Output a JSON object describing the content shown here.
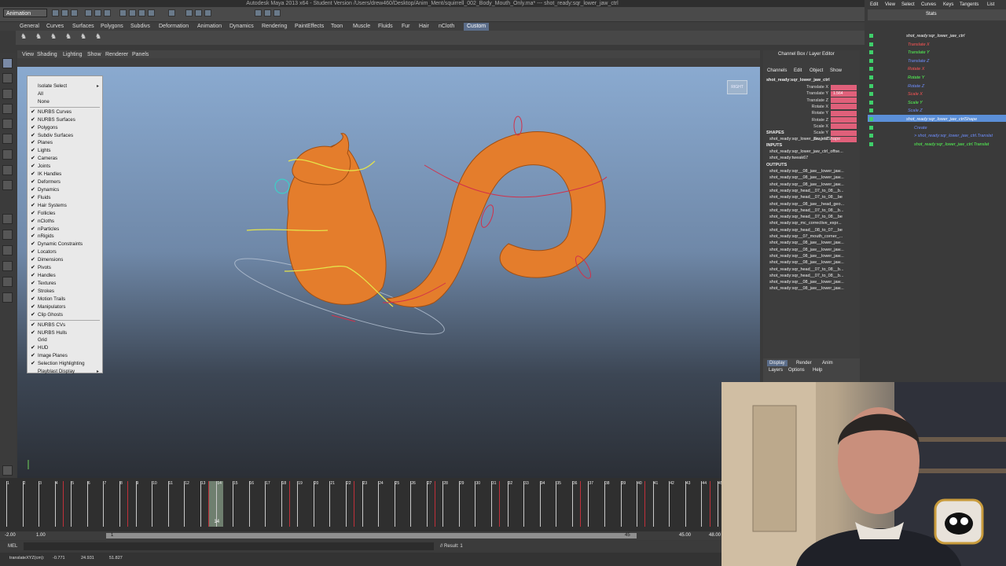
{
  "window": {
    "title": "Autodesk Maya 2013 x64 - Student Version  /Users/drew460/Desktop/Anim_Ment/squirrell_002_Body_Mouth_Only.ma*   ---   shot_ready:sqr_lower_jaw_ctrl"
  },
  "toolbar": {
    "mode": "Animation"
  },
  "shelf_tabs": [
    "General",
    "Curves",
    "Surfaces",
    "Polygons",
    "Subdivs",
    "Deformation",
    "Animation",
    "Dynamics",
    "Rendering",
    "PaintEffects",
    "Toon",
    "Muscle",
    "Fluids",
    "Fur",
    "Hair",
    "nCloth",
    "Custom"
  ],
  "shelf_tabs_active": "Custom",
  "panel_menu": [
    "View",
    "Shading",
    "Lighting",
    "Show",
    "Renderer",
    "Panels"
  ],
  "show_menu": {
    "items": [
      {
        "label": "Isolate Select",
        "check": false,
        "submenu": true
      },
      {
        "label": "All",
        "check": false
      },
      {
        "label": "None",
        "check": false
      },
      {
        "sep": true
      },
      {
        "label": "NURBS Curves",
        "check": true
      },
      {
        "label": "NURBS Surfaces",
        "check": true
      },
      {
        "label": "Polygons",
        "check": true
      },
      {
        "label": "Subdiv Surfaces",
        "check": true
      },
      {
        "label": "Planes",
        "check": true
      },
      {
        "label": "Lights",
        "check": true
      },
      {
        "label": "Cameras",
        "check": true
      },
      {
        "label": "Joints",
        "check": true
      },
      {
        "label": "IK Handles",
        "check": true
      },
      {
        "label": "Deformers",
        "check": true
      },
      {
        "label": "Dynamics",
        "check": true
      },
      {
        "label": "Fluids",
        "check": true
      },
      {
        "label": "Hair Systems",
        "check": true
      },
      {
        "label": "Follicles",
        "check": true
      },
      {
        "label": "nCloths",
        "check": true
      },
      {
        "label": "nParticles",
        "check": true
      },
      {
        "label": "nRigids",
        "check": true
      },
      {
        "label": "Dynamic Constraints",
        "check": true
      },
      {
        "label": "Locators",
        "check": true
      },
      {
        "label": "Dimensions",
        "check": true
      },
      {
        "label": "Pivots",
        "check": true
      },
      {
        "label": "Handles",
        "check": true
      },
      {
        "label": "Textures",
        "check": true
      },
      {
        "label": "Strokes",
        "check": true
      },
      {
        "label": "Motion Trails",
        "check": true
      },
      {
        "label": "Manipulators",
        "check": true
      },
      {
        "label": "Clip Ghosts",
        "check": true
      },
      {
        "sep": true
      },
      {
        "label": "NURBS CVs",
        "check": true
      },
      {
        "label": "NURBS Hulls",
        "check": true
      },
      {
        "label": "Grid",
        "check": false
      },
      {
        "label": "HUD",
        "check": true
      },
      {
        "label": "Image Planes",
        "check": true
      },
      {
        "label": "Selection Highlighting",
        "check": true
      },
      {
        "label": "Playblast Display",
        "check": false,
        "submenu": true
      }
    ]
  },
  "viewport": {
    "view_cube_label": "RIGHT"
  },
  "timeline": {
    "frames": [
      "1",
      "2",
      "3",
      "4",
      "5",
      "6",
      "7",
      "8",
      "9",
      "10",
      "11",
      "12",
      "13",
      "14",
      "15",
      "16",
      "17",
      "18",
      "19",
      "20",
      "21",
      "22",
      "23",
      "24",
      "25",
      "26",
      "27",
      "28",
      "29",
      "30",
      "31",
      "32",
      "33",
      "34",
      "35",
      "36",
      "37",
      "38",
      "39",
      "40",
      "41",
      "42",
      "43",
      "44",
      "45"
    ],
    "current_frame": "14",
    "keys": [
      4,
      8,
      13,
      18,
      22,
      27,
      31,
      36,
      40,
      44
    ]
  },
  "range": {
    "start": "-2.00",
    "playback_start": "1.00",
    "slider_start": "1",
    "slider_end": "45",
    "playback_end": "45.00",
    "end": "48.00"
  },
  "command_line": {
    "mel_label": "MEL",
    "result": "// Result: 1"
  },
  "help_line": {
    "label": "translateXYZ(cm):",
    "x": "-0.771",
    "y": "24.931",
    "z": "51.827"
  },
  "channel_box": {
    "header": "Channel Box / Layer Editor",
    "menu": [
      "Channels",
      "Edit",
      "Object",
      "Show"
    ],
    "object": "shot_ready:sqr_lower_jaw_ctrl",
    "attrs": [
      "Translate X",
      "Translate Y",
      "Translate Z",
      "Rotate X",
      "Rotate Y",
      "Rotate Z",
      "Scale X",
      "Scale Y",
      "Scale Z"
    ],
    "ty_value": "1.564",
    "shapes_label": "SHAPES",
    "shape": "shot_ready:sqr_lower_jaw_ctrlShape",
    "inputs_label": "INPUTS",
    "inputs": [
      "shot_ready:sqr_lower_jaw_ctrl_offse...",
      "shot_ready:tweak67"
    ],
    "outputs_label": "OUTPUTS",
    "outputs": [
      "shot_ready:sqr__08_jaw__lower_jaw...",
      "shot_ready:sqr__08_jaw__lower_jaw...",
      "shot_ready:sqr__08_jaw__lower_jaw...",
      "shot_ready:sqr_head__07_to_08__b...",
      "shot_ready:sqr_head__07_to_08__be",
      "shot_ready:sqr__08_jaw__head_geo...",
      "shot_ready:sqr_head__07_to_08__b...",
      "shot_ready:sqr_head__07_to_08__be",
      "shot_ready:sqr_mc_corrective_expr...",
      "shot_ready:sqr_head__08_to_07__be",
      "shot_ready:sqr__07_mouth_corner_...",
      "shot_ready:sqr__08_jaw__lower_jaw...",
      "shot_ready:sqr__08_jaw__lower_jaw...",
      "shot_ready:sqr__08_jaw__lower_jaw...",
      "shot_ready:sqr__08_jaw__lower_jaw...",
      "shot_ready:sqr_head__07_to_08__b...",
      "shot_ready:sqr_head__07_to_08__b...",
      "shot_ready:sqr__08_jaw__lower_jaw...",
      "shot_ready:sqr__08_jaw__lower_jaw..."
    ]
  },
  "layer_editor": {
    "tabs": [
      "Display",
      "Render",
      "Anim"
    ],
    "active_tab": "Display",
    "menu": [
      "Layers",
      "Options",
      "Help"
    ]
  },
  "graph_editor": {
    "menu": [
      "Edit",
      "View",
      "Select",
      "Curves",
      "Keys",
      "Tangents",
      "List"
    ],
    "stats_label": "Stats",
    "items": [
      {
        "label": "shot_ready:sqr_lower_jaw_ctrl",
        "color": "#ffffff"
      },
      {
        "label": "Translate X",
        "color": "#ff5555"
      },
      {
        "label": "Translate Y",
        "color": "#55ff55"
      },
      {
        "label": "Translate Z",
        "color": "#6f8fff"
      },
      {
        "label": "Rotate X",
        "color": "#ff5555"
      },
      {
        "label": "Rotate Y",
        "color": "#55ff55"
      },
      {
        "label": "Rotate Z",
        "color": "#6f8fff"
      },
      {
        "label": "Scale X",
        "color": "#ff5555"
      },
      {
        "label": "Scale Y",
        "color": "#55ff55"
      },
      {
        "label": "Scale Z",
        "color": "#6f8fff"
      },
      {
        "label": "shot_ready:sqr_lower_jaw_ctrlShape",
        "color": "#ffffff"
      },
      {
        "label": "Create",
        "color": "#6f8fff"
      },
      {
        "label": "> shot_ready:sqr_lower_jaw_ctrl.Translat",
        "color": "#6f8fff"
      },
      {
        "label": "shot_ready:sqr_lower_jaw_ctrl.Translat",
        "color": "#55ff55"
      }
    ]
  },
  "colors": {
    "accent": "#5b6d8a",
    "squirrel": "#e47d2c",
    "channel_value": "#e0607a",
    "key_tick": "#c0303a"
  }
}
